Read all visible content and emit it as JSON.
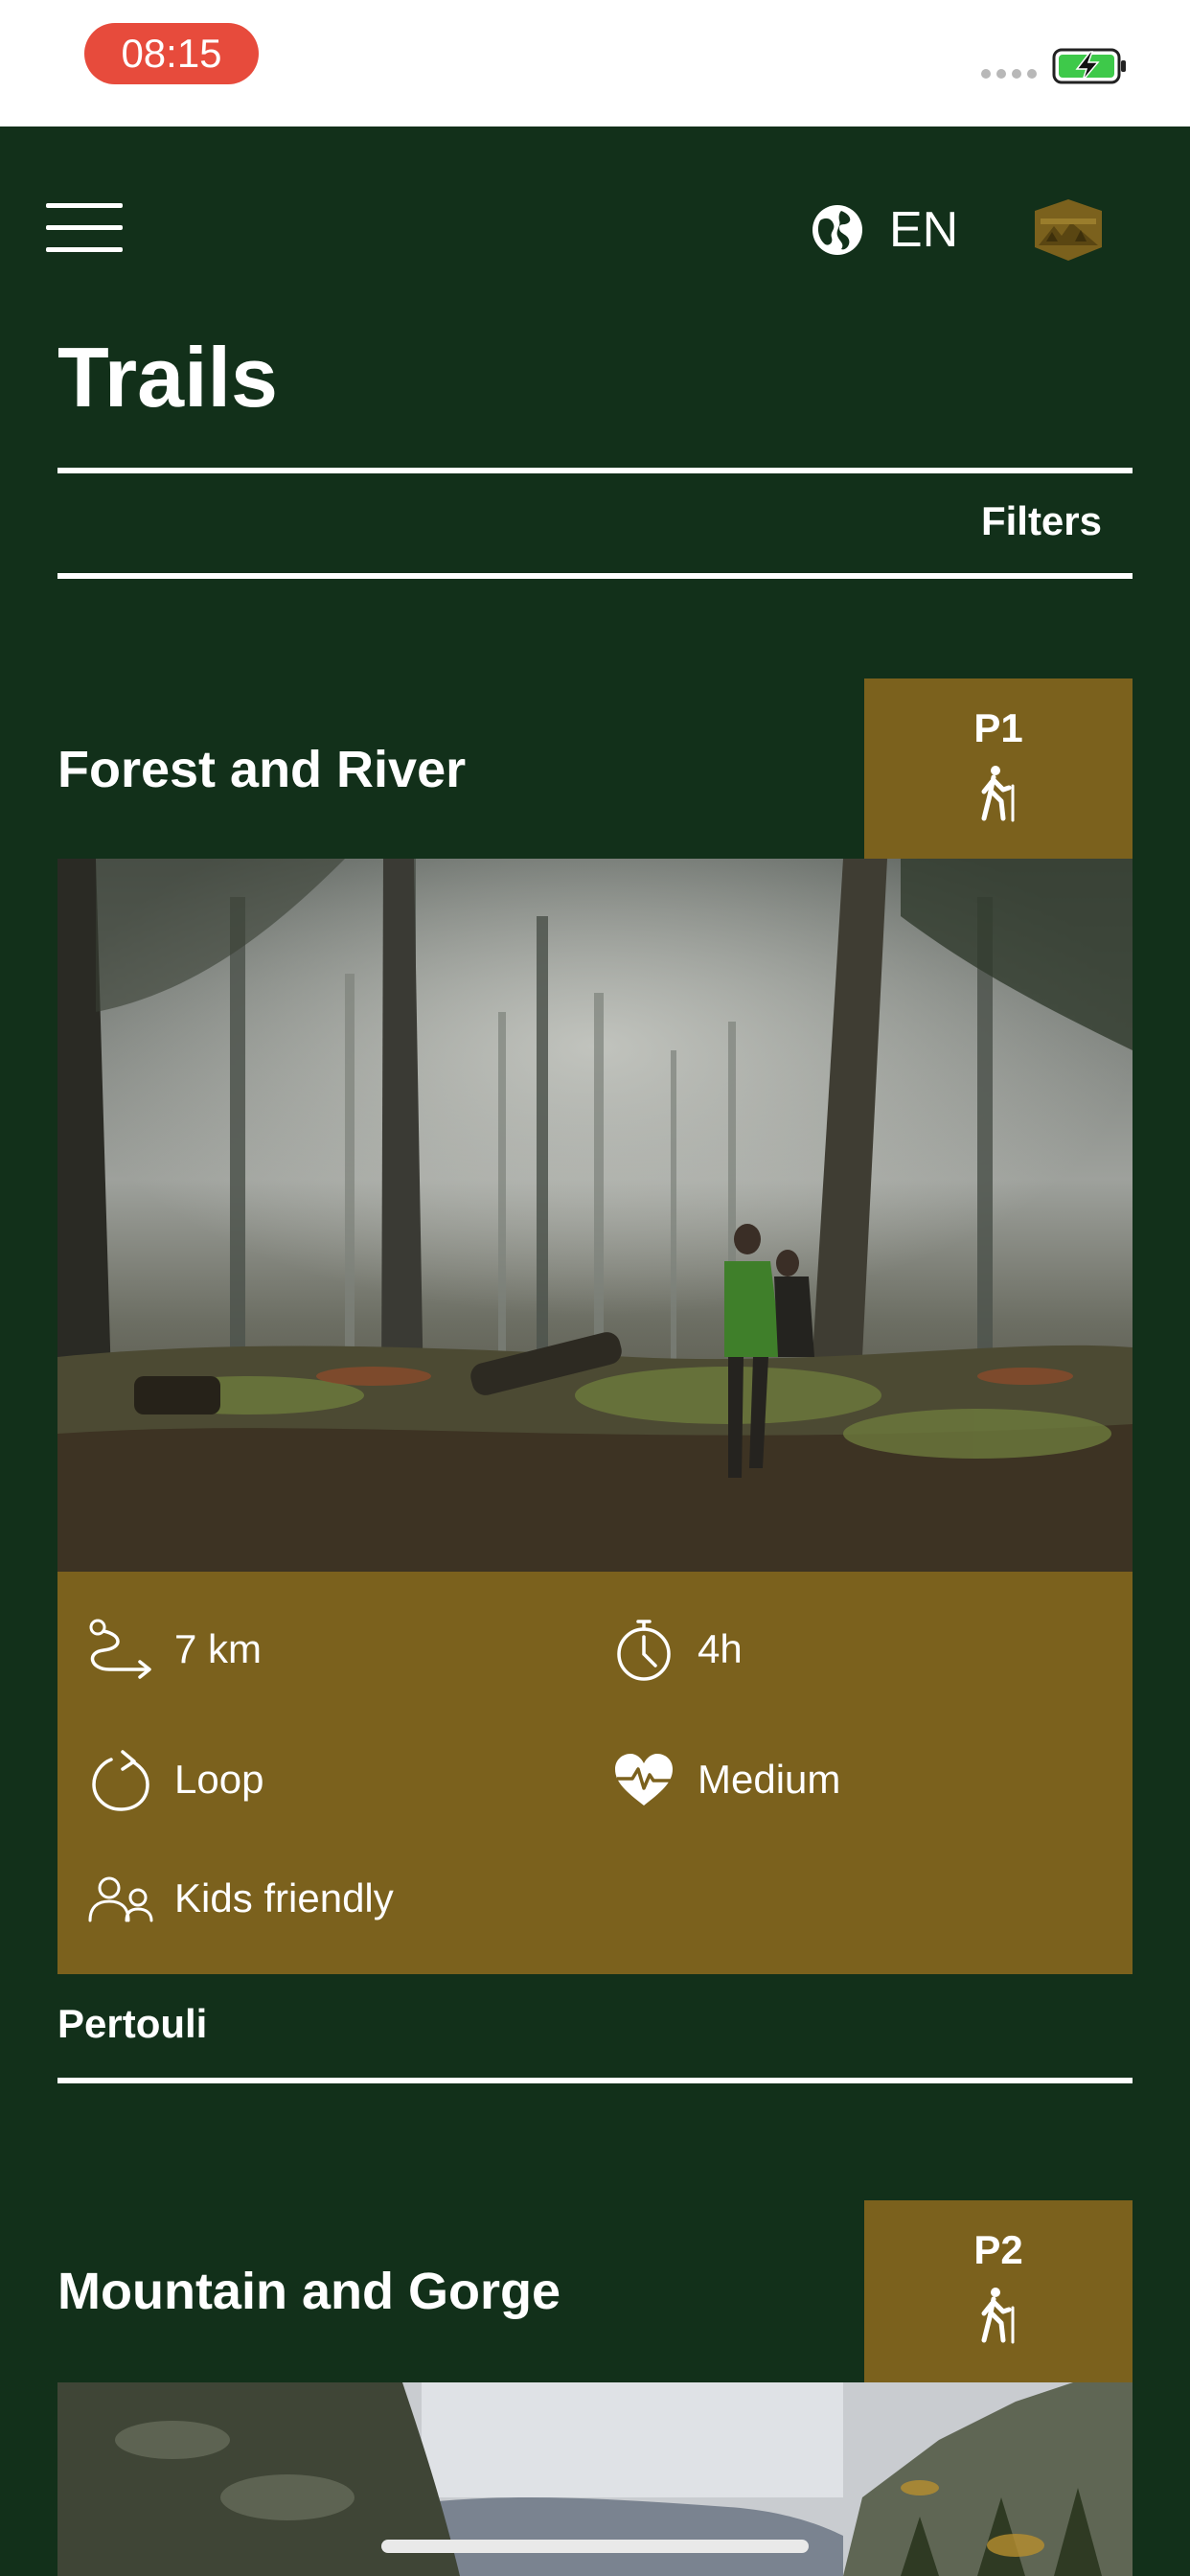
{
  "status": {
    "time": "08:15"
  },
  "header": {
    "language": "EN"
  },
  "page": {
    "title": "Trails",
    "filters_label": "Filters"
  },
  "trails": [
    {
      "code": "P1",
      "name": "Forest and River",
      "distance": "7 km",
      "duration": "4h",
      "route_type": "Loop",
      "difficulty": "Medium",
      "audience": "Kids friendly",
      "location": "Pertouli"
    },
    {
      "code": "P2",
      "name": "Mountain and Gorge"
    }
  ],
  "colors": {
    "background": "#12301a",
    "accent": "#7b611d",
    "time_pill": "#e74b3c"
  },
  "icons": [
    "menu-icon",
    "globe-icon",
    "pertouli-logo",
    "hiker-icon",
    "route-icon",
    "stopwatch-icon",
    "loop-icon",
    "heartbeat-icon",
    "people-icon",
    "battery-icon"
  ]
}
